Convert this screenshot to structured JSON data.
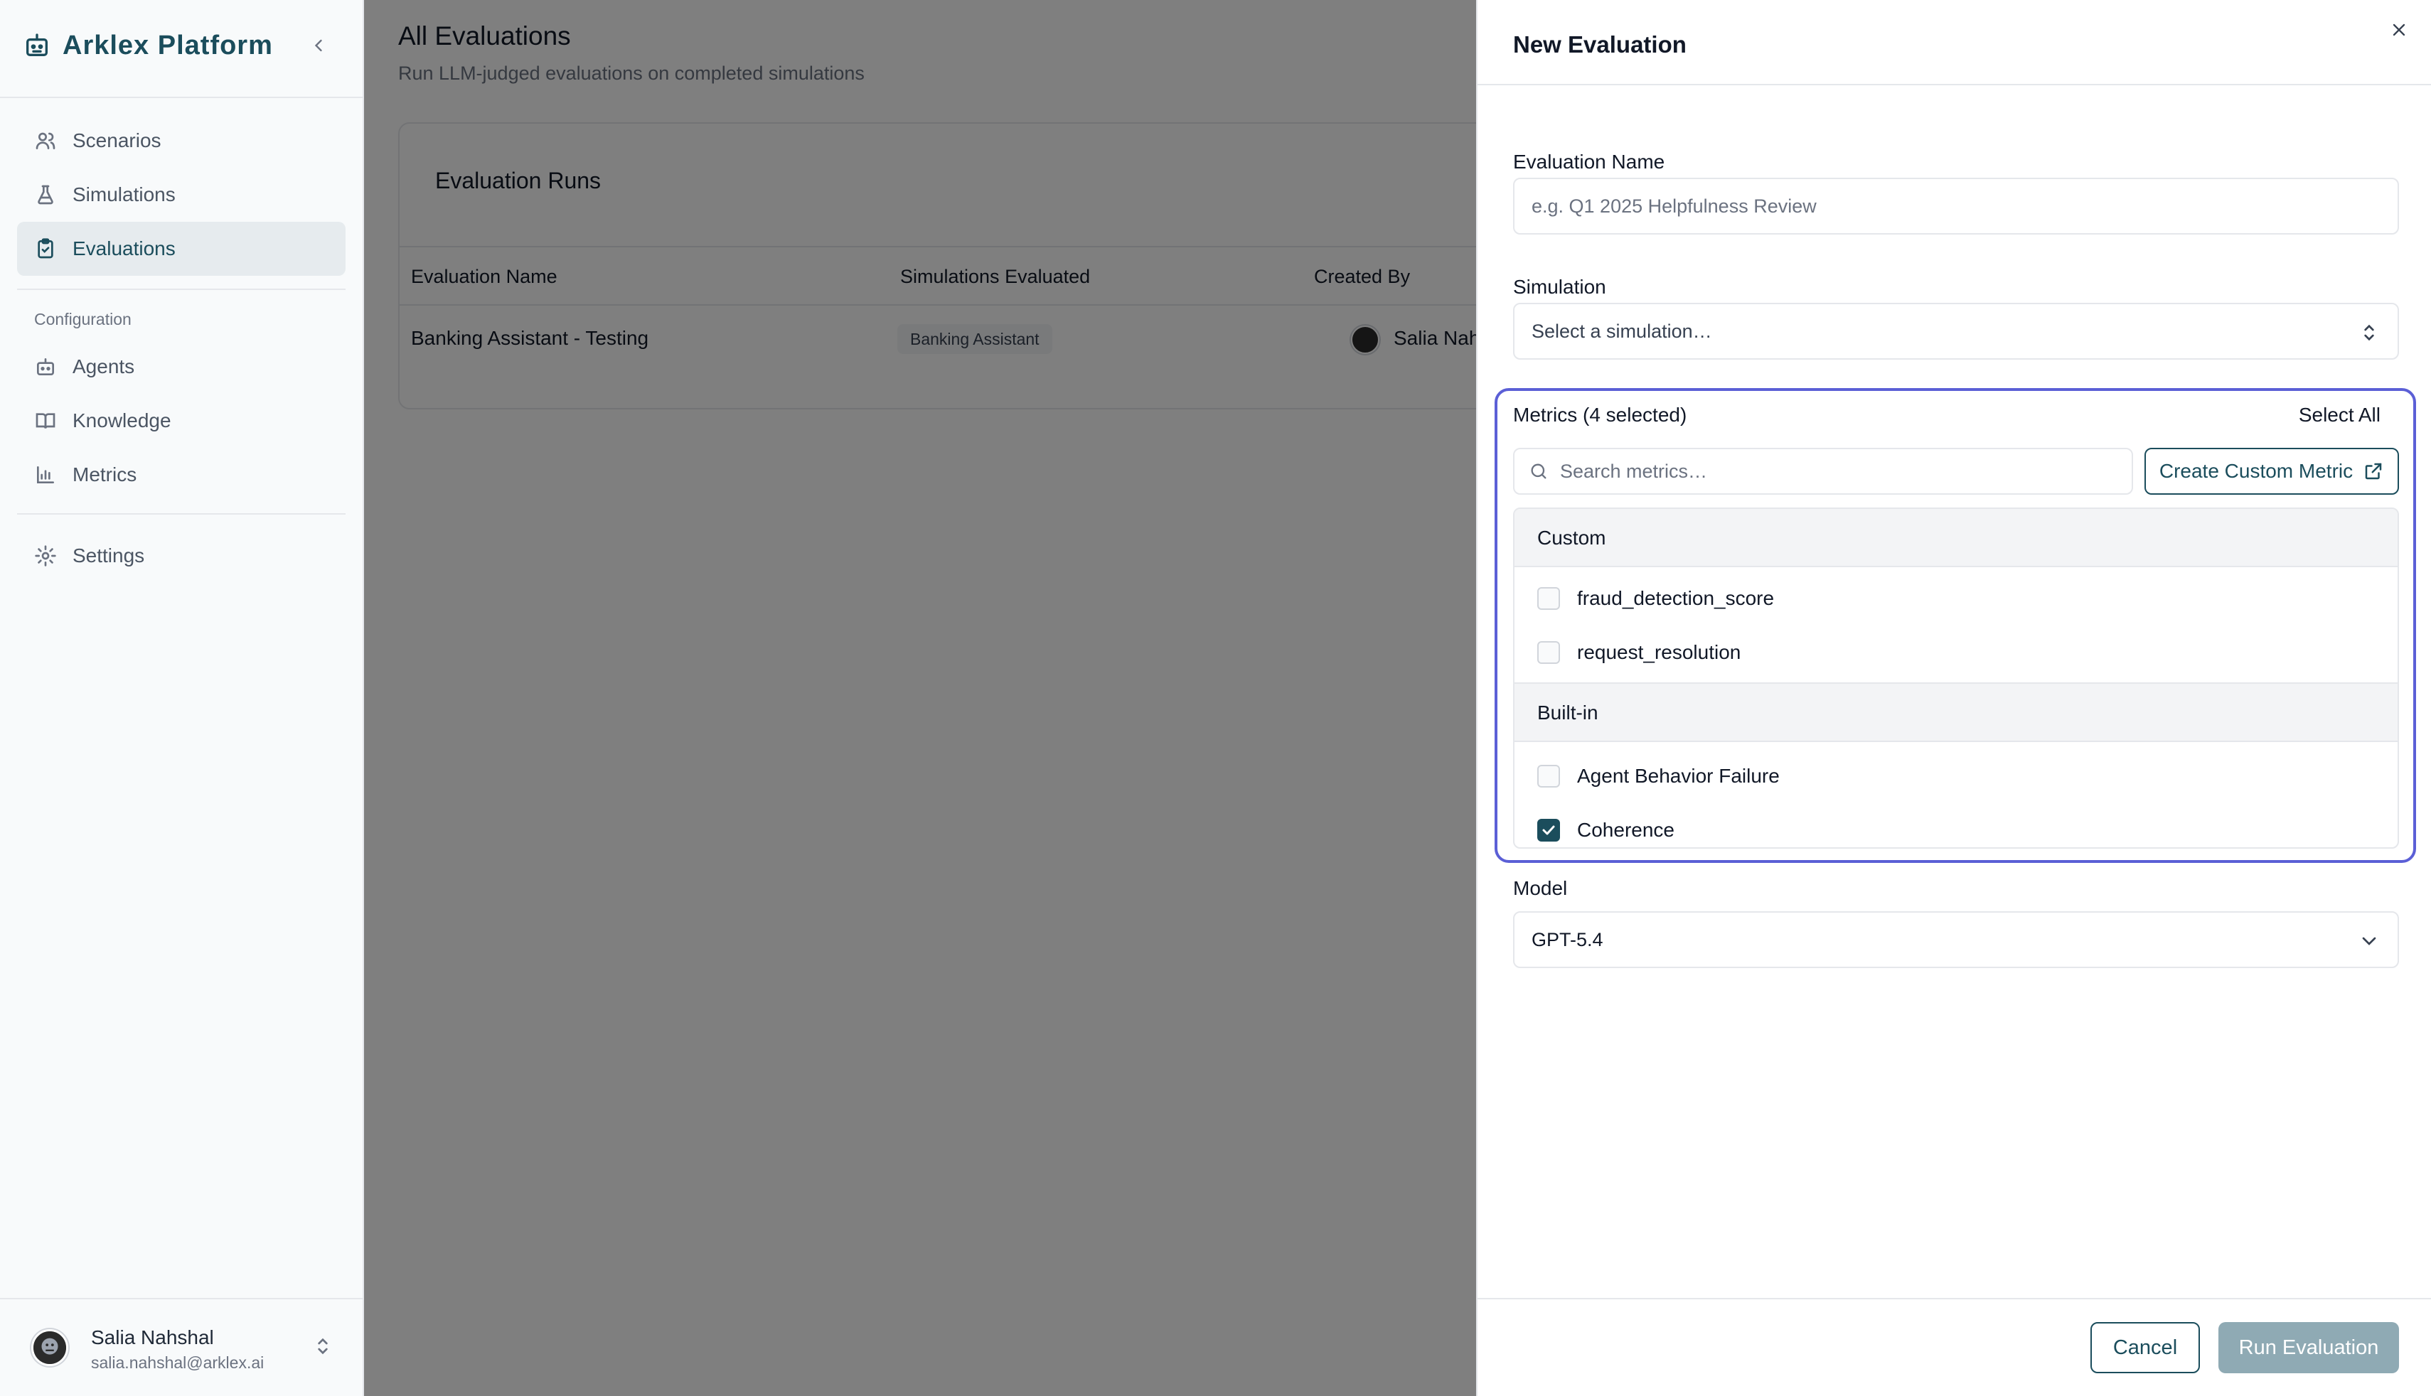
{
  "sidebar": {
    "brand": "Arklex Platform",
    "items": [
      {
        "label": "Scenarios",
        "icon": "users-icon"
      },
      {
        "label": "Simulations",
        "icon": "flask-icon"
      },
      {
        "label": "Evaluations",
        "icon": "clipboard-check-icon",
        "active": true
      }
    ],
    "config_label": "Configuration",
    "config_items": [
      {
        "label": "Agents",
        "icon": "bot-icon"
      },
      {
        "label": "Knowledge",
        "icon": "book-icon"
      },
      {
        "label": "Metrics",
        "icon": "bar-chart-icon"
      }
    ],
    "settings_label": "Settings",
    "user": {
      "name": "Salia Nahshal",
      "email": "salia.nahshal@arklex.ai"
    }
  },
  "main": {
    "title": "All Evaluations",
    "subtitle": "Run LLM-judged evaluations on completed simulations",
    "card_title": "Evaluation Runs",
    "columns": [
      "Evaluation Name",
      "Simulations Evaluated",
      "Created By"
    ],
    "rows": [
      {
        "name": "Banking Assistant - Testing",
        "simulation": "Banking Assistant",
        "created_by": "Salia Nahshal"
      }
    ]
  },
  "drawer": {
    "title": "New Evaluation",
    "name_label": "Evaluation Name",
    "name_placeholder": "e.g. Q1 2025 Helpfulness Review",
    "simulation_label": "Simulation",
    "simulation_placeholder": "Select a simulation…",
    "metrics_label": "Metrics (4 selected)",
    "select_all": "Select All",
    "search_placeholder": "Search metrics…",
    "create_metric": "Create Custom Metric",
    "groups": [
      {
        "name": "Custom",
        "items": [
          {
            "label": "fraud_detection_score",
            "checked": false
          },
          {
            "label": "request_resolution",
            "checked": false
          }
        ]
      },
      {
        "name": "Built-in",
        "items": [
          {
            "label": "Agent Behavior Failure",
            "checked": false
          },
          {
            "label": "Coherence",
            "checked": true
          }
        ]
      }
    ],
    "model_label": "Model",
    "model_value": "GPT-5.4",
    "cancel": "Cancel",
    "run": "Run Evaluation"
  },
  "colors": {
    "brand": "#1b4d5c",
    "focus_ring": "#5b5fd6",
    "run_disabled": "#8faab4"
  }
}
